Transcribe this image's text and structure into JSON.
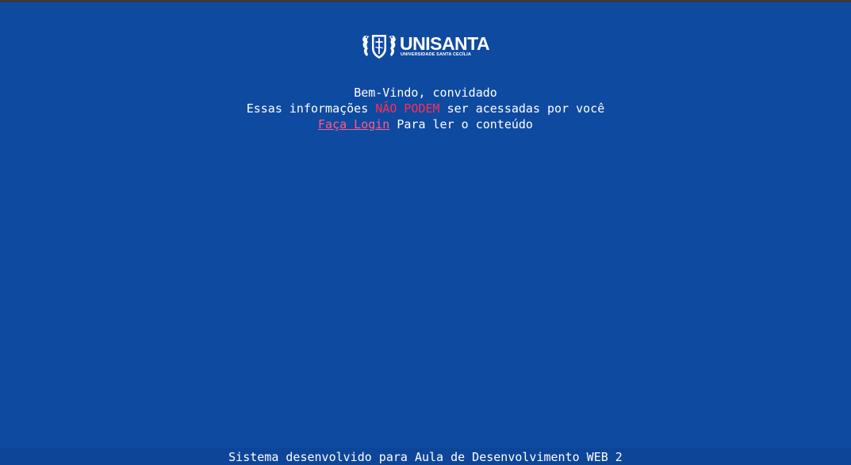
{
  "logo": {
    "emblem_icon": "seahorse-crest-icon",
    "name": "UNISANTA",
    "subtitle": "UNIVERSIDADE SANTA CECÍLIA"
  },
  "message": {
    "welcome": "Bem-Vindo, convidado",
    "line2_prefix": "Essas informações ",
    "line2_warning": "NÃO PODEM",
    "line2_suffix": " ser acessadas por você",
    "login_link": "Faça Login",
    "line3_suffix": " Para ler o conteúdo"
  },
  "footer": {
    "text": "Sistema desenvolvido para Aula de Desenvolvimento WEB 2"
  },
  "colors": {
    "background": "#0f4aa1",
    "warning": "#ff2d55",
    "link": "#ff5a8c"
  }
}
